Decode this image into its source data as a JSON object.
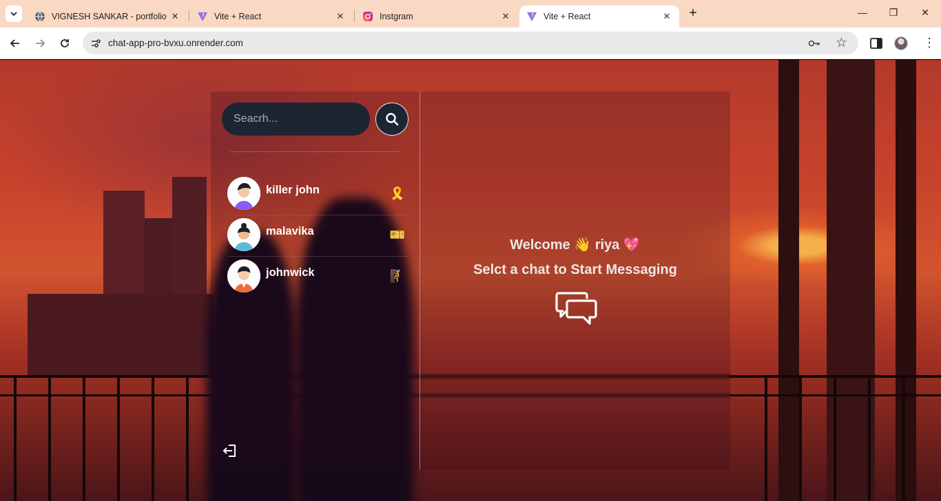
{
  "browser": {
    "tabs": [
      {
        "title": "VIGNESH SANKAR - portfolio",
        "favicon": "globe-icon",
        "active": false
      },
      {
        "title": "Vite + React",
        "favicon": "vite-icon",
        "active": false
      },
      {
        "title": "Instgram",
        "favicon": "instagram-icon",
        "active": false
      },
      {
        "title": "Vite + React",
        "favicon": "vite-icon",
        "active": true
      }
    ],
    "url": "chat-app-pro-bvxu.onrender.com"
  },
  "sidebar": {
    "search_placeholder": "Seacrh...",
    "conversations": [
      {
        "name": "killer john",
        "emoji": "🎗️"
      },
      {
        "name": "malavika",
        "emoji": "🎫"
      },
      {
        "name": "johnwick",
        "emoji": "🧗"
      }
    ]
  },
  "main": {
    "welcome_prefix": "Welcome",
    "wave_emoji": "👋",
    "username": "riya",
    "heart_emoji": "💖",
    "prompt": "Selct a chat to Start Messaging"
  },
  "colors": {
    "tabstrip": "#f9d9c3",
    "panel_dark": "#1d2533",
    "text_light": "#f1e6e6"
  }
}
